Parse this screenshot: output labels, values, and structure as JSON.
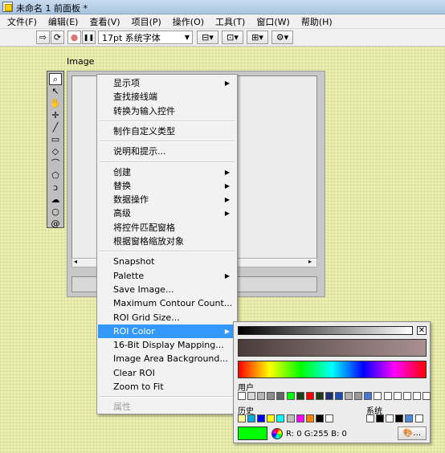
{
  "window": {
    "title": "未命名 1 前面板 *"
  },
  "menubar": [
    "文件(F)",
    "编辑(E)",
    "查看(V)",
    "项目(P)",
    "操作(O)",
    "工具(T)",
    "窗口(W)",
    "帮助(H)"
  ],
  "toolbar": {
    "run_glyph": "⇨",
    "run_continuous_glyph": "⟳",
    "abort_glyph": "●",
    "pause_glyph": "❚❚",
    "font": "17pt 系统字体",
    "align_glyph": "⊟▾",
    "distribute_glyph": "⊡▾",
    "resize_glyph": "⊞▾",
    "reorder_glyph": "⚙▾"
  },
  "control": {
    "label": "Image",
    "scroll_left": "◂",
    "scroll_right": "▸"
  },
  "palette_tools": [
    {
      "name": "zoom-tool-icon",
      "glyph": "⌕"
    },
    {
      "name": "select-arrow-icon",
      "glyph": "↖"
    },
    {
      "name": "pan-hand-icon",
      "glyph": "✋"
    },
    {
      "name": "point-tool-icon",
      "glyph": "✛"
    },
    {
      "name": "line-tool-icon",
      "glyph": "╱"
    },
    {
      "name": "rectangle-tool-icon",
      "glyph": "▭"
    },
    {
      "name": "rotated-rect-tool-icon",
      "glyph": "◇"
    },
    {
      "name": "annulus-tool-icon",
      "glyph": "⌒"
    },
    {
      "name": "polygon-tool-icon",
      "glyph": "⬠"
    },
    {
      "name": "freehand-tool-icon",
      "glyph": "ↄ"
    },
    {
      "name": "freehand-region-icon",
      "glyph": "☁"
    },
    {
      "name": "oval-tool-icon",
      "glyph": "○"
    },
    {
      "name": "spiral-tool-icon",
      "glyph": "@"
    }
  ],
  "context_menu": [
    {
      "label": "显示项",
      "arrow": "▶"
    },
    {
      "label": "查找接线端"
    },
    {
      "label": "转换为输入控件"
    },
    {
      "sep": true
    },
    {
      "label": "制作自定义类型"
    },
    {
      "sep": true
    },
    {
      "label": "说明和提示..."
    },
    {
      "sep": true
    },
    {
      "label": "创建",
      "arrow": "▶"
    },
    {
      "label": "替换",
      "arrow": "▶"
    },
    {
      "label": "数据操作",
      "arrow": "▶"
    },
    {
      "label": "高级",
      "arrow": "▶"
    },
    {
      "label": "将控件匹配窗格"
    },
    {
      "label": "根据窗格缩放对象"
    },
    {
      "sep": true
    },
    {
      "label": "Snapshot"
    },
    {
      "label": "Palette",
      "arrow": "▶"
    },
    {
      "label": "Save Image..."
    },
    {
      "label": "Maximum Contour Count..."
    },
    {
      "label": "ROI Grid Size..."
    },
    {
      "label": "ROI Color",
      "arrow": "▶",
      "highlight": true
    },
    {
      "label": "16-Bit Display Mapping..."
    },
    {
      "label": "Image Area Background..."
    },
    {
      "label": "Clear ROI"
    },
    {
      "label": "Zoom to Fit"
    },
    {
      "sep": true
    },
    {
      "label": "属性",
      "disabled": true
    }
  ],
  "color_picker": {
    "close_glyph": "✕",
    "user_label": "用户",
    "history_label": "历史",
    "system_label": "系统",
    "user_colors": [
      "#ffffff",
      "#d8d8d8",
      "#b4b4b4",
      "#8c8c8c",
      "#646464",
      "#00ff00",
      "#1e3f14",
      "#ff0000",
      "#1f3a1f",
      "#1f2f6f",
      "#1f4fb0",
      "#b0b0b0",
      "#9a9a9a",
      "#4a78d0",
      "#ffffff",
      "#ffffff",
      "#ffffff",
      "#ffffff",
      "#ffffff",
      "#ffffff"
    ],
    "history_colors": [
      "#ffff99",
      "#00aadd",
      "#0000ff",
      "#ffff00",
      "#00ffff",
      "#c0c0c0",
      "#ff00ff",
      "#ff8000",
      "#000000",
      "#ffffff"
    ],
    "system_colors": [
      "#ffffff",
      "#000000",
      "#ffffff",
      "#000000",
      "#4a8ad8",
      "#ffffff"
    ],
    "current_color": "#00ff00",
    "readout": "R:  0 G:255 B:  0",
    "more_glyph": "🎨…"
  }
}
